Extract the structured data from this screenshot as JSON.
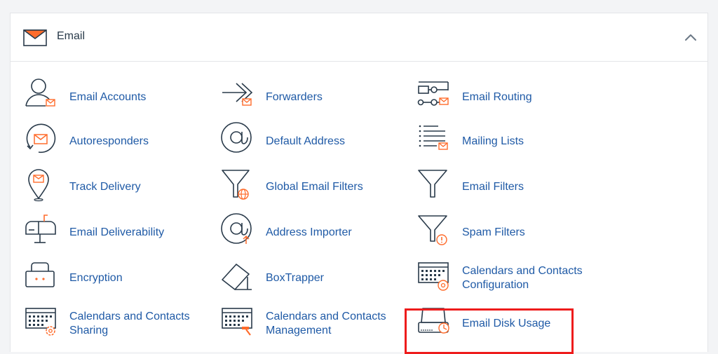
{
  "section": {
    "title": "Email",
    "accent_color": "#ff6c2c",
    "link_color": "#1f5aa6",
    "collapse_icon": "chevron-up-icon"
  },
  "items": [
    {
      "id": "email-accounts",
      "label": "Email Accounts",
      "icon": "user-email-icon"
    },
    {
      "id": "forwarders",
      "label": "Forwarders",
      "icon": "forward-arrow-icon"
    },
    {
      "id": "email-routing",
      "label": "Email Routing",
      "icon": "routing-icon"
    },
    {
      "id": "autoresponders",
      "label": "Autoresponders",
      "icon": "autoresponder-icon"
    },
    {
      "id": "default-address",
      "label": "Default Address",
      "icon": "at-sign-icon"
    },
    {
      "id": "mailing-lists",
      "label": "Mailing Lists",
      "icon": "list-email-icon"
    },
    {
      "id": "track-delivery",
      "label": "Track Delivery",
      "icon": "map-pin-email-icon"
    },
    {
      "id": "global-email-filters",
      "label": "Global Email Filters",
      "icon": "funnel-globe-icon"
    },
    {
      "id": "email-filters",
      "label": "Email Filters",
      "icon": "funnel-icon"
    },
    {
      "id": "email-deliverability",
      "label": "Email Deliverability",
      "icon": "mailbox-icon"
    },
    {
      "id": "address-importer",
      "label": "Address Importer",
      "icon": "at-import-icon"
    },
    {
      "id": "spam-filters",
      "label": "Spam Filters",
      "icon": "funnel-warning-icon"
    },
    {
      "id": "encryption",
      "label": "Encryption",
      "icon": "lock-icon"
    },
    {
      "id": "boxtrapper",
      "label": "BoxTrapper",
      "icon": "box-trap-icon"
    },
    {
      "id": "calendars-contacts-config",
      "label": "Calendars and Contacts Configuration",
      "icon": "keyboard-at-icon"
    },
    {
      "id": "calendars-contacts-sharing",
      "label": "Calendars and Contacts Sharing",
      "icon": "keyboard-gear-icon"
    },
    {
      "id": "calendars-contacts-management",
      "label": "Calendars and Contacts Management",
      "icon": "keyboard-hammer-icon"
    },
    {
      "id": "email-disk-usage",
      "label": "Email Disk Usage",
      "icon": "disk-usage-icon"
    }
  ]
}
